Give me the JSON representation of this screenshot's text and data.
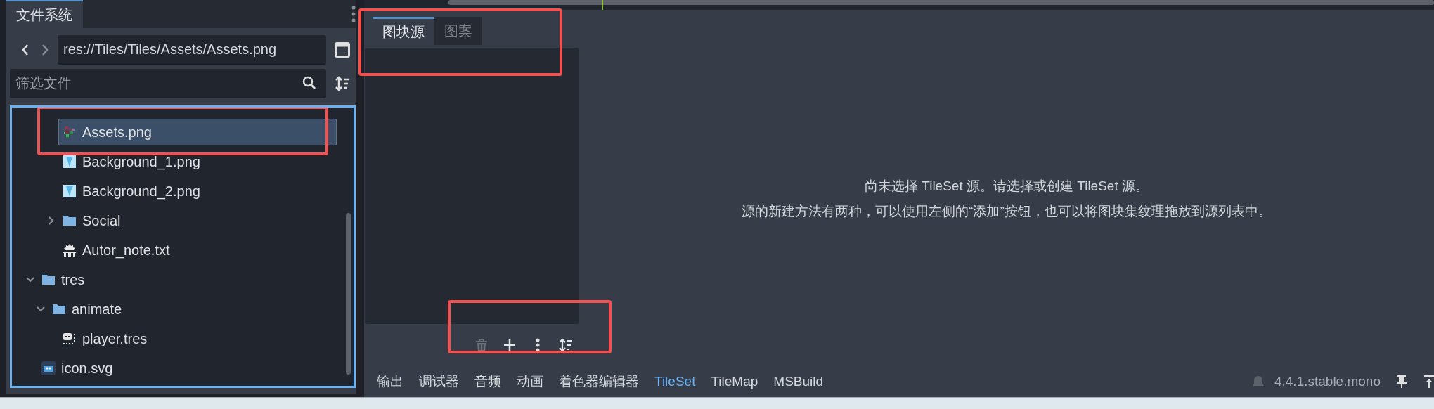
{
  "filesystem": {
    "tab": {
      "label": "文件系统",
      "selected": true
    },
    "path": "res://Tiles/Tiles/Assets/Assets.png",
    "filter": {
      "placeholder": "筛选文件"
    },
    "tree": [
      {
        "children": [
          {
            "children": [
              {
                "name": "Assets.png",
                "kind": "sprite",
                "selected": true,
                "highlighted": true
              },
              {
                "name": "Background_1.png",
                "kind": "image",
                "selected": false,
                "highlighted": false
              },
              {
                "name": "Background_2.png",
                "kind": "image",
                "selected": false,
                "highlighted": false
              },
              {
                "name": "Social",
                "kind": "folder",
                "expanded": false,
                "selected": false,
                "highlighted": false
              },
              {
                "name": "Autor_note.txt",
                "kind": "text",
                "selected": false,
                "highlighted": false
              }
            ]
          }
        ]
      },
      {
        "name": "tres",
        "kind": "folder",
        "expanded": true,
        "selected": false,
        "highlighted": false,
        "children": [
          {
            "name": "animate",
            "kind": "folder",
            "expanded": true,
            "selected": false,
            "highlighted": false,
            "children": [
              {
                "name": "player.tres",
                "kind": "resource",
                "selected": false,
                "highlighted": false
              }
            ]
          }
        ]
      },
      {
        "name": "icon.svg",
        "kind": "svg",
        "selected": false,
        "highlighted": false
      }
    ]
  },
  "tileset_editor": {
    "tabs": [
      {
        "label": "图块源",
        "selected": true
      },
      {
        "label": "图案",
        "selected": false
      }
    ],
    "tabs_highlighted": true,
    "toolbar": {
      "highlighted": true,
      "buttons": [
        {
          "kind": "delete",
          "disabled": true
        },
        {
          "kind": "add",
          "disabled": false
        },
        {
          "kind": "menu",
          "disabled": false
        },
        {
          "kind": "sort",
          "disabled": false
        }
      ]
    },
    "message": [
      "尚未选择 TileSet 源。请选择或创建 TileSet 源。",
      "源的新建方法有两种，可以使用左侧的“添加”按钮，也可以将图块集纹理拖放到源列表中。"
    ]
  },
  "bottom_panel": {
    "tabs": [
      {
        "label": "输出",
        "selected": false
      },
      {
        "label": "调试器",
        "selected": false
      },
      {
        "label": "音频",
        "selected": false
      },
      {
        "label": "动画",
        "selected": false
      },
      {
        "label": "着色器编辑器",
        "selected": false
      },
      {
        "label": "TileSet",
        "selected": true
      },
      {
        "label": "TileMap",
        "selected": false
      },
      {
        "label": "MSBuild",
        "selected": false
      }
    ],
    "version": "4.4.1.stable.mono"
  }
}
